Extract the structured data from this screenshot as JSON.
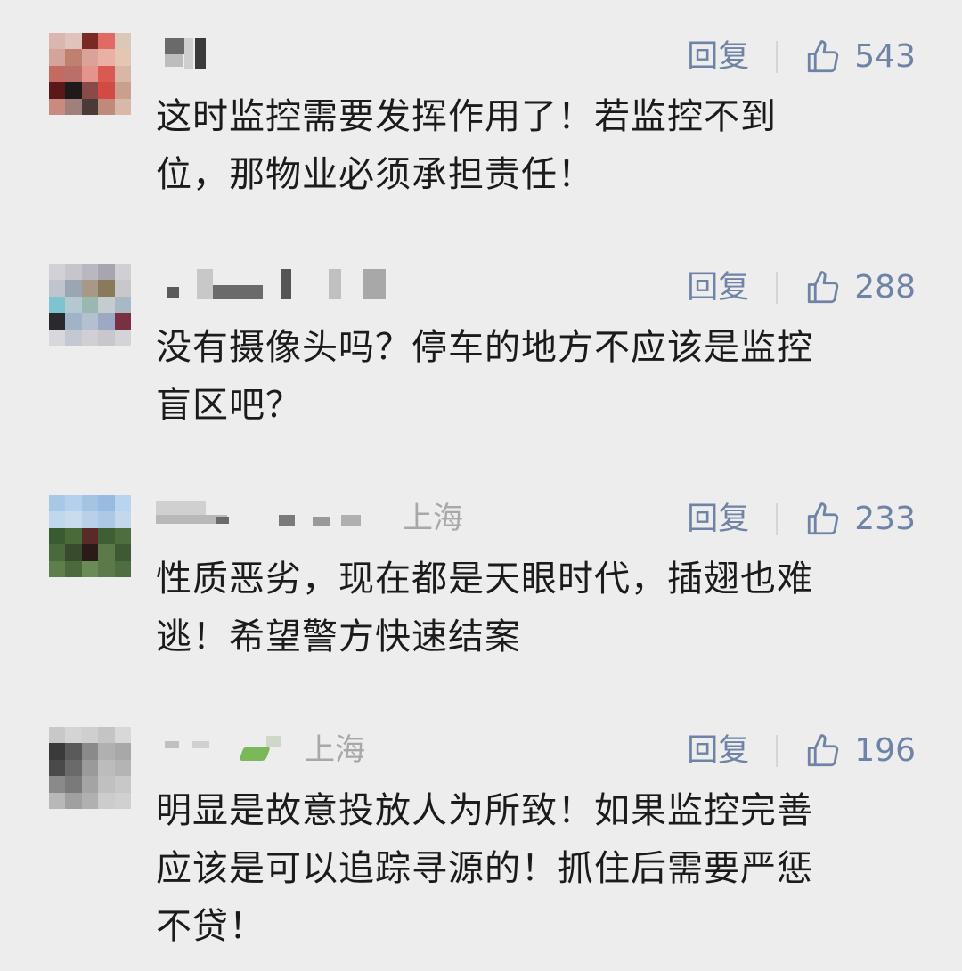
{
  "comments": [
    {
      "location": "",
      "reply_label": "回复",
      "likes": "543",
      "text": "这时监控需要发挥作用了！若监控不到\n位，那物业必须承担责任！"
    },
    {
      "location": "",
      "reply_label": "回复",
      "likes": "288",
      "text": "没有摄像头吗？停车的地方不应该是监控\n盲区吧？"
    },
    {
      "location": "上海",
      "reply_label": "回复",
      "likes": "233",
      "text": "性质恶劣，现在都是天眼时代，插翅也难\n逃！希望警方快速结案"
    },
    {
      "location": "上海",
      "reply_label": "回复",
      "likes": "196",
      "text": "明显是故意投放人为所致！如果监控完善\n应该是可以追踪寻源的！抓住后需要严惩\n不贷！"
    }
  ],
  "colors": {
    "background": "#ededed",
    "action_text": "#6e83a6",
    "location_text": "#a8a8a8"
  },
  "icons": {
    "like": "thumbs-up-icon"
  }
}
